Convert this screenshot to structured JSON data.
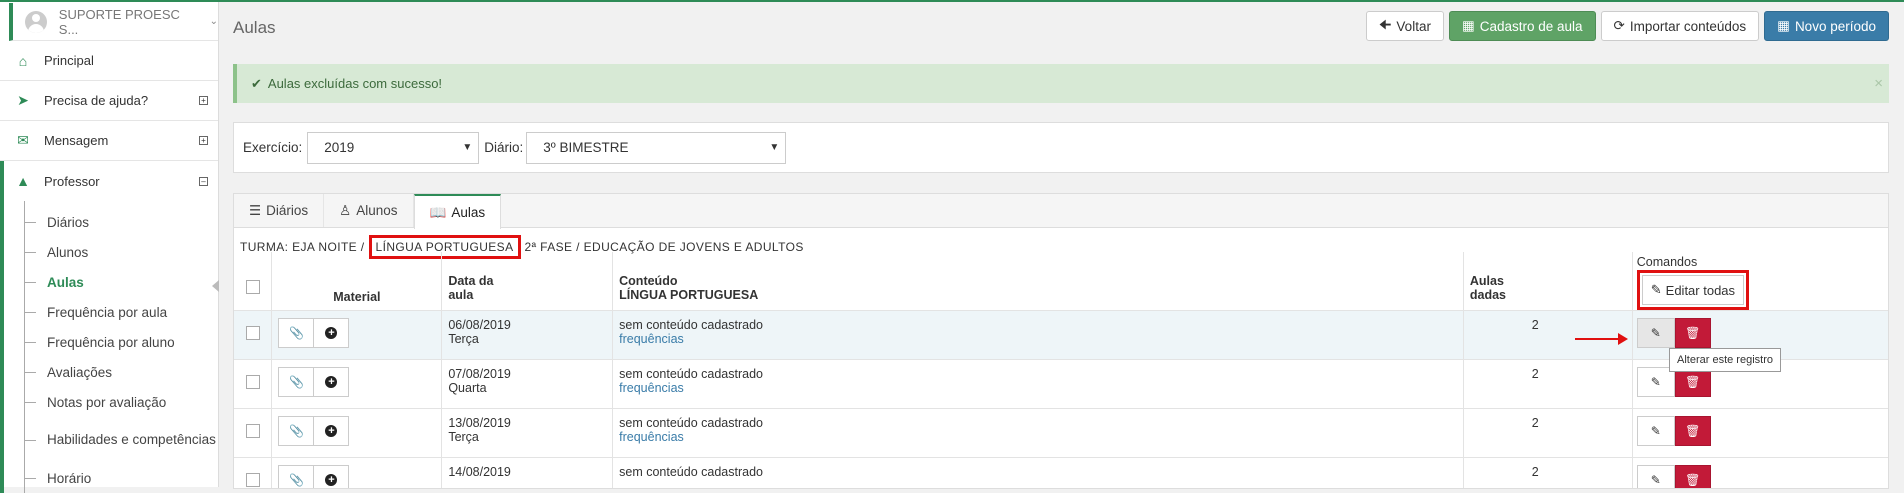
{
  "sidebar": {
    "user": "SUPORTE PROESC S...",
    "items": [
      {
        "label": "Principal",
        "icon": "home-icon"
      },
      {
        "label": "Precisa de ajuda?",
        "icon": "megaphone-icon"
      },
      {
        "label": "Mensagem",
        "icon": "envelope-icon"
      },
      {
        "label": "Professor",
        "icon": "graduation-cap-icon"
      }
    ],
    "submenu": [
      "Diários",
      "Alunos",
      "Aulas",
      "Frequência por aula",
      "Frequência por aluno",
      "Avaliações",
      "Notas por avaliação",
      "Habilidades e competências",
      "Horário"
    ],
    "active": "Aulas"
  },
  "page": {
    "title": "Aulas",
    "buttons": {
      "back": "Voltar",
      "register": "Cadastro de aula",
      "import": "Importar conteúdos",
      "new_period": "Novo período"
    },
    "alert": "Aulas excluídas com sucesso!",
    "filters": {
      "exercicio_label": "Exercício:",
      "exercicio_value": "2019",
      "diario_label": "Diário:",
      "diario_value": "3º BIMESTRE"
    },
    "tabs": [
      "Diários",
      "Alunos",
      "Aulas"
    ],
    "turma": {
      "prefix": "TURMA: EJA NOITE /",
      "discipline": "LÍNGUA PORTUGUESA",
      "suffix": "2ª FASE / EDUCAÇÃO DE JOVENS E ADULTOS"
    },
    "table": {
      "headers": {
        "material": "Material",
        "data_1": "Data da",
        "data_2": "aula",
        "conteudo_1": "Conteúdo",
        "conteudo_2": "LÍNGUA PORTUGUESA",
        "aulas_1": "Aulas",
        "aulas_2": "dadas",
        "comandos": "Comandos",
        "edit_all": "Editar todas"
      },
      "rows": [
        {
          "date": "06/08/2019",
          "day": "Terça",
          "content": "sem conteúdo cadastrado",
          "link": "frequências",
          "aulas": "2"
        },
        {
          "date": "07/08/2019",
          "day": "Quarta",
          "content": "sem conteúdo cadastrado",
          "link": "frequências",
          "aulas": "2"
        },
        {
          "date": "13/08/2019",
          "day": "Terça",
          "content": "sem conteúdo cadastrado",
          "link": "frequências",
          "aulas": "2"
        },
        {
          "date": "14/08/2019",
          "day": "",
          "content": "sem conteúdo cadastrado",
          "link": "",
          "aulas": "2"
        }
      ]
    },
    "tooltip": "Alterar este registro"
  }
}
